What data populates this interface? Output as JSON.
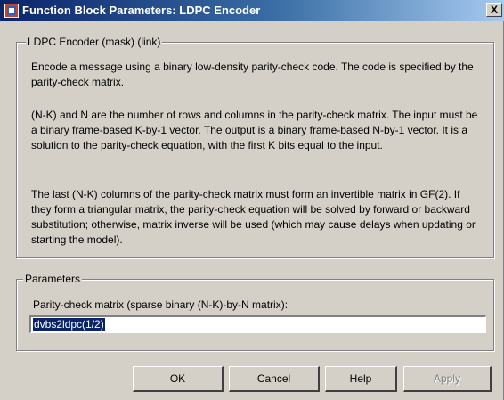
{
  "window": {
    "title": "Function Block Parameters: LDPC Encoder",
    "close_label": "X"
  },
  "mask_group": {
    "label": "LDPC Encoder (mask) (link)",
    "paragraphs": [
      "Encode a message using a binary low-density parity-check code. The code is specified by the parity-check matrix.",
      "(N-K) and N are the number of rows and columns in the parity-check matrix. The input must be a binary frame-based K-by-1 vector. The output is a binary frame-based N-by-1 vector. It is a solution to the parity-check equation, with the first K bits equal to the input.",
      "The last (N-K) columns of the parity-check matrix must form an invertible matrix in GF(2). If they form a triangular matrix, the parity-check equation will be solved by forward or backward substitution; otherwise, matrix inverse will be used (which may cause delays when updating or starting the model)."
    ]
  },
  "parameters_group": {
    "label": "Parameters",
    "field_label": "Parity-check matrix (sparse binary (N-K)-by-N matrix):",
    "field_value": "dvbs2ldpc(1/2)"
  },
  "buttons": {
    "ok": "OK",
    "cancel": "Cancel",
    "help": "Help",
    "apply": "Apply"
  },
  "colors": {
    "title_active": "#0a246a",
    "dialog_face": "#d4d0c8",
    "selection": "#0a246a"
  }
}
